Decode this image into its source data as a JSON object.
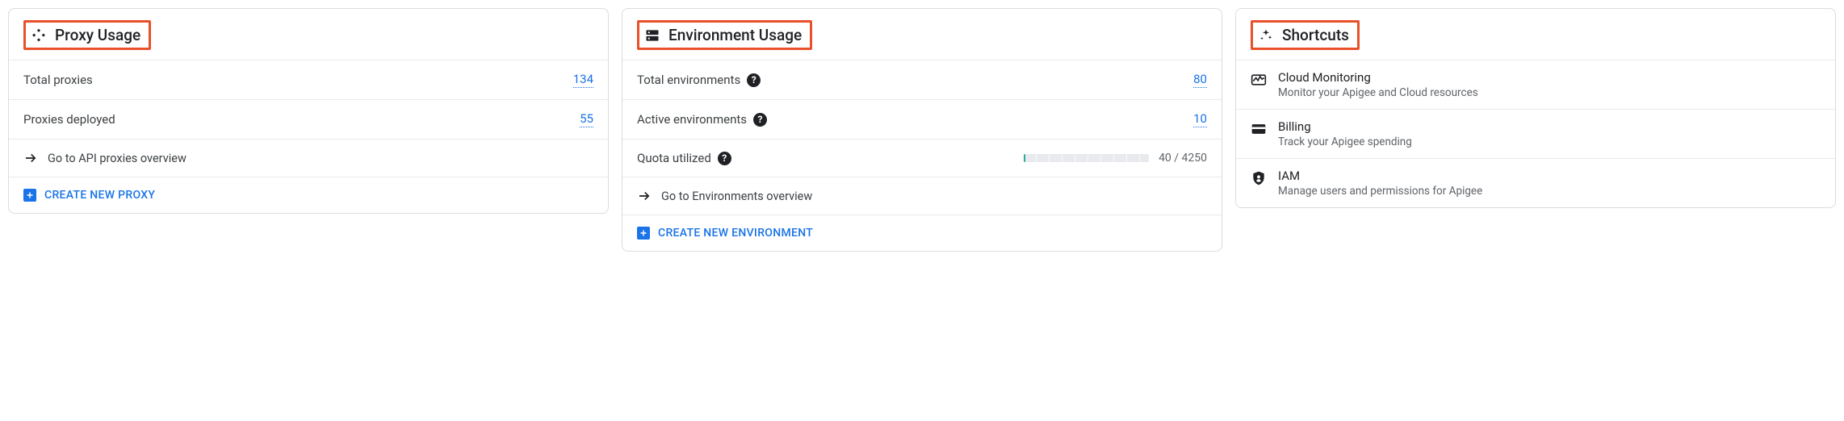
{
  "proxy_usage": {
    "title": "Proxy Usage",
    "rows": {
      "total_proxies": {
        "label": "Total proxies",
        "value": "134"
      },
      "proxies_deployed": {
        "label": "Proxies deployed",
        "value": "55"
      }
    },
    "overview_link": "Go to API proxies overview",
    "create_action": "CREATE NEW PROXY"
  },
  "env_usage": {
    "title": "Environment Usage",
    "rows": {
      "total_envs": {
        "label": "Total environments",
        "value": "80"
      },
      "active_envs": {
        "label": "Active environments",
        "value": "10"
      },
      "quota": {
        "label": "Quota utilized",
        "used": 40,
        "total": 4250,
        "display": "40 / 4250"
      }
    },
    "overview_link": "Go to Environments overview",
    "create_action": "CREATE NEW ENVIRONMENT"
  },
  "shortcuts": {
    "title": "Shortcuts",
    "items": [
      {
        "title": "Cloud Monitoring",
        "desc": "Monitor your Apigee and Cloud resources"
      },
      {
        "title": "Billing",
        "desc": "Track your Apigee spending"
      },
      {
        "title": "IAM",
        "desc": "Manage users and permissions for Apigee"
      }
    ]
  }
}
